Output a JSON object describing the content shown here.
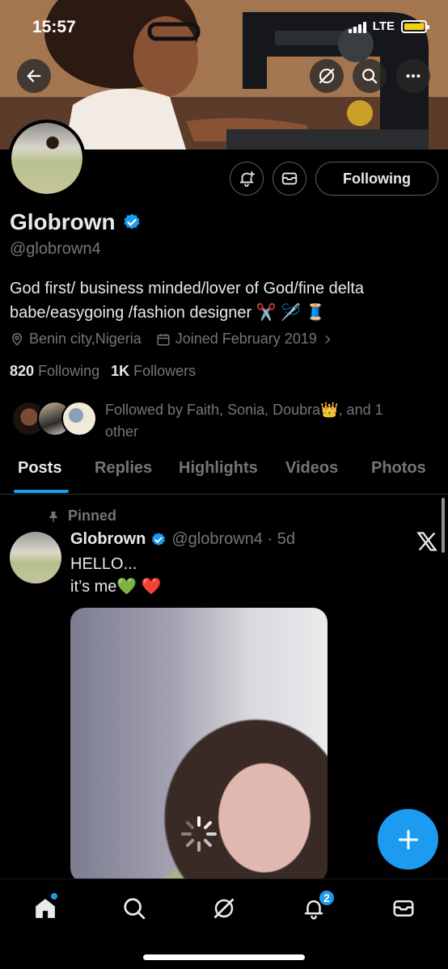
{
  "status_bar": {
    "time": "15:57",
    "network": "LTE",
    "battery_color": "#f2d30b"
  },
  "profile": {
    "display_name": "Globrown",
    "handle": "@globrown4",
    "bio": "God first/ business minded/lover of God/fine delta babe/easygoing /fashion designer ✂️ 🪡 🧵",
    "location": "Benin city,Nigeria",
    "joined": "Joined February 2019",
    "following_count": "820",
    "following_label": "Following",
    "followers_count": "1K",
    "followers_label": "Followers",
    "followed_by": "Followed by Faith, Sonia, Doubra👑, and 1 other",
    "follow_button": "Following"
  },
  "tabs": [
    "Posts",
    "Replies",
    "Highlights",
    "Videos",
    "Photos"
  ],
  "post": {
    "pinned_label": "Pinned",
    "author": "Globrown",
    "handle_time": "@globrown4 · 5d",
    "line1": "HELLO...",
    "line2": "it’s me💚 ❤️"
  },
  "bottom_nav": {
    "notifications_badge": "2",
    "icons": [
      "home-icon",
      "search-icon",
      "grok-icon",
      "bell-icon",
      "mail-icon"
    ]
  },
  "colors": {
    "accent": "#1d9bf0",
    "muted": "#71767b",
    "text": "#e7e9ea",
    "background": "#000000"
  }
}
